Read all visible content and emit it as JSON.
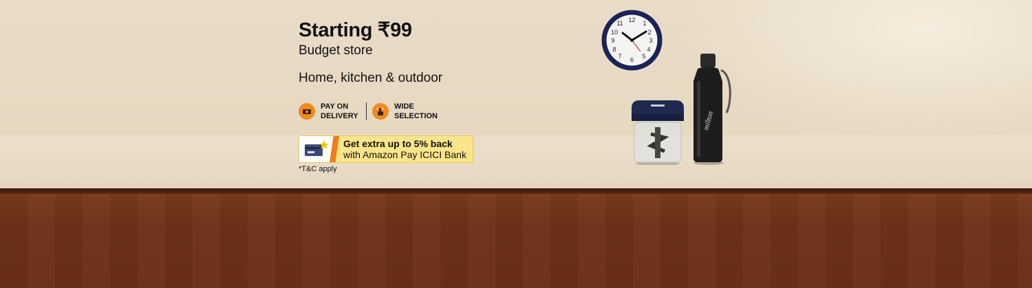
{
  "banner": {
    "headline": "Starting ₹99",
    "subtitle": "Budget store",
    "category": "Home, kitchen & outdoor",
    "badges": [
      {
        "icon": "cash-delivery-icon",
        "label": "PAY ON DELIVERY"
      },
      {
        "icon": "hand-pointer-icon",
        "label": "WIDE SELECTION"
      }
    ],
    "offer": {
      "line1": "Get extra up to 5% back",
      "line2": "with Amazon Pay ICICI Bank",
      "icon": "credit-card-icon"
    },
    "terms": "*T&C apply",
    "products": [
      {
        "name": "wall-clock"
      },
      {
        "name": "vegetable-chopper"
      },
      {
        "name": "water-bottle",
        "brand_text": "milton"
      }
    ]
  },
  "colors": {
    "accent_orange": "#f08a1c",
    "offer_yellow": "#fbe58a",
    "wood_brown": "#6b3119",
    "wall_beige": "#e9dcc7"
  }
}
